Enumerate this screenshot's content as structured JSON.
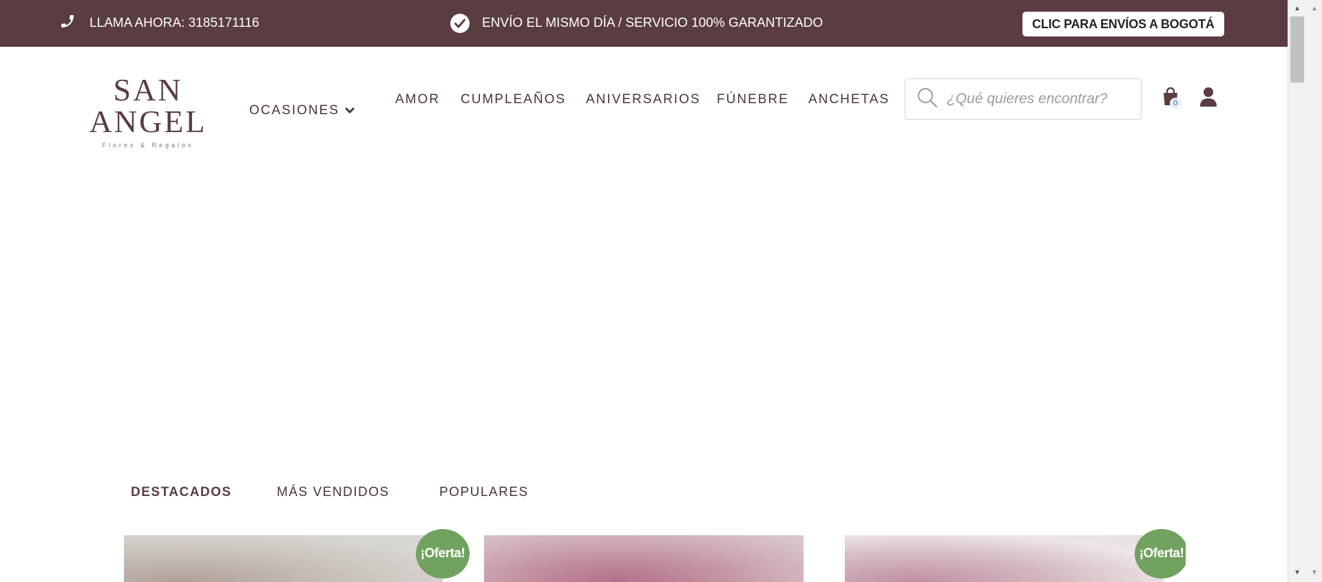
{
  "topbar": {
    "call_text": "LLAMA AHORA: 3185171116",
    "shipping_text": "ENVÍO EL MISMO DÍA / SERVICIO 100% GARANTIZADO",
    "cta_label": "CLIC PARA ENVÍOS A BOGOTÁ",
    "background": "#5a3d40"
  },
  "header": {
    "logo_name": "SAN ANGEL",
    "logo_tagline": "Flores & Regalos",
    "nav": {
      "occasions": "OCASIONES",
      "love": "AMOR",
      "birthdays": "CUMPLEAÑOS",
      "anniversaries": "ANIVERSARIOS",
      "funeral": "FÚNEBRE",
      "gift_baskets": "ANCHETAS"
    },
    "search": {
      "placeholder": "¿Qué quieres encontrar?",
      "value": ""
    },
    "cart_count": "0",
    "icons": {
      "phone": "phone-icon",
      "check": "check-circle-icon",
      "search": "search-icon",
      "cart": "shopping-bag-icon",
      "user": "user-icon",
      "chevron": "chevron-down-icon"
    }
  },
  "tabs": {
    "featured": "DESTACADOS",
    "best_sellers": "MÁS VENDIDOS",
    "popular": "POPULARES"
  },
  "products": {
    "sale_badge": "¡Oferta!",
    "sale_badge_color": "#72a260"
  }
}
